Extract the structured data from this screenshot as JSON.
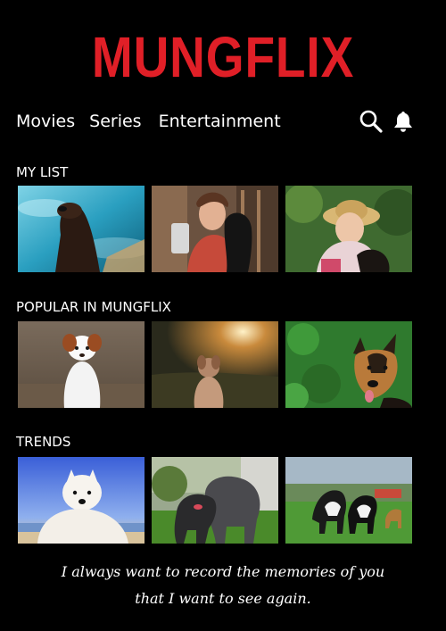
{
  "app": {
    "logo": "MUNGFLIX",
    "brand_color": "#e01f27",
    "background": "#000000"
  },
  "nav": {
    "items": [
      {
        "label": "Movies"
      },
      {
        "label": "Series"
      },
      {
        "label": "Entertainment"
      }
    ],
    "icons": [
      "search-icon",
      "bell-icon"
    ]
  },
  "sections": [
    {
      "title": "MY LIST",
      "thumbnails": [
        {
          "subject": "dog-in-water"
        },
        {
          "subject": "woman-with-dog-selfie"
        },
        {
          "subject": "grandmother-with-dog"
        }
      ]
    },
    {
      "title": "POPULAR IN MUNGFLIX",
      "thumbnails": [
        {
          "subject": "border-collie-puppy"
        },
        {
          "subject": "dog-at-sunset"
        },
        {
          "subject": "german-shepherd"
        }
      ]
    },
    {
      "title": "TRENDS",
      "thumbnails": [
        {
          "subject": "white-samoyed-at-beach"
        },
        {
          "subject": "two-dogs-playing"
        },
        {
          "subject": "dogs-running-on-grass"
        }
      ]
    }
  ],
  "footer": {
    "quote_line1": "I always want to record the memories of you",
    "quote_line2": "that I want to see again."
  }
}
